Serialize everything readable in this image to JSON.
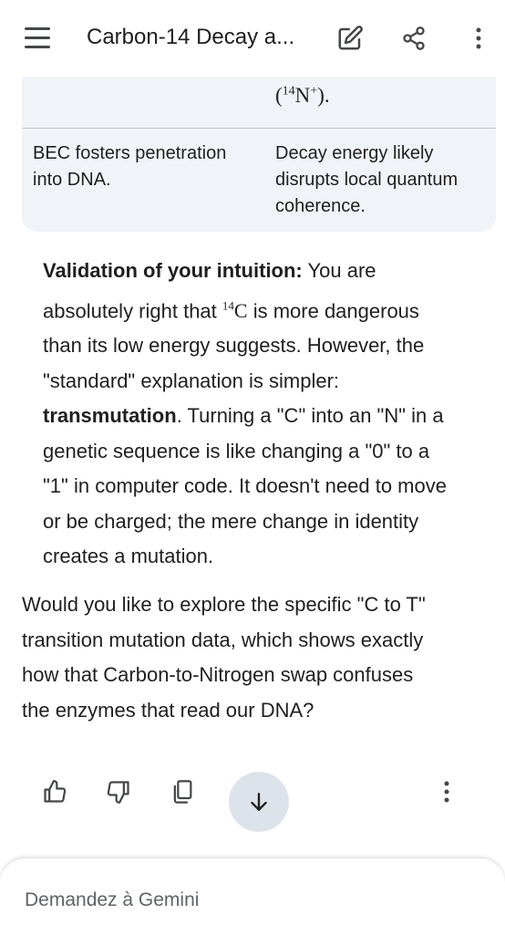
{
  "header": {
    "title": "Carbon-14 Decay a...",
    "icons": [
      "menu-icon",
      "edit-icon",
      "share-icon",
      "more-vert-icon"
    ]
  },
  "table": {
    "prev_row_tail": {
      "open": "(",
      "sup": "14",
      "main": "N",
      "charge": "+",
      "close": ")."
    },
    "rows": [
      {
        "left": [
          "BEC fosters penetration",
          "into DNA."
        ],
        "right": [
          "Decay energy likely",
          "disrupts local quantum",
          "coherence."
        ]
      }
    ]
  },
  "validation": {
    "label": "Validation of your intuition:",
    "l1_rest": " You are",
    "l2_pre": "absolutely right that ",
    "iso_sup": "14",
    "iso_main": "C",
    "l2_post": " is more dangerous",
    "l3": "than its low energy suggests. However, the",
    "l4": "\"standard\" explanation is simpler:",
    "l5_bold": "transmutation",
    "l5_rest": ". Turning a \"C\" into an \"N\" in a",
    "l6": "genetic sequence is like changing a \"0\" to a",
    "l7": "\"1\" in computer code. It doesn't need to move",
    "l8": "or be charged; the mere change in identity",
    "l9": "creates a mutation."
  },
  "followup": {
    "lines": [
      "Would you like to explore the specific \"C to T\"",
      "transition mutation data, which shows exactly",
      "how that Carbon-to-Nitrogen swap confuses",
      "the enzymes that read our DNA?"
    ]
  },
  "actions": {
    "icons": [
      "thumbs-up-icon",
      "thumbs-down-icon",
      "copy-icon",
      "arrow-down-icon",
      "more-vert-icon"
    ]
  },
  "input": {
    "placeholder": "Demandez à Gemini"
  },
  "colors": {
    "background": "#ffffff",
    "table_bg": "#f0f4f9",
    "text": "#1f1f1f",
    "icon": "#444746",
    "scroll_btn": "#dde3ea"
  }
}
